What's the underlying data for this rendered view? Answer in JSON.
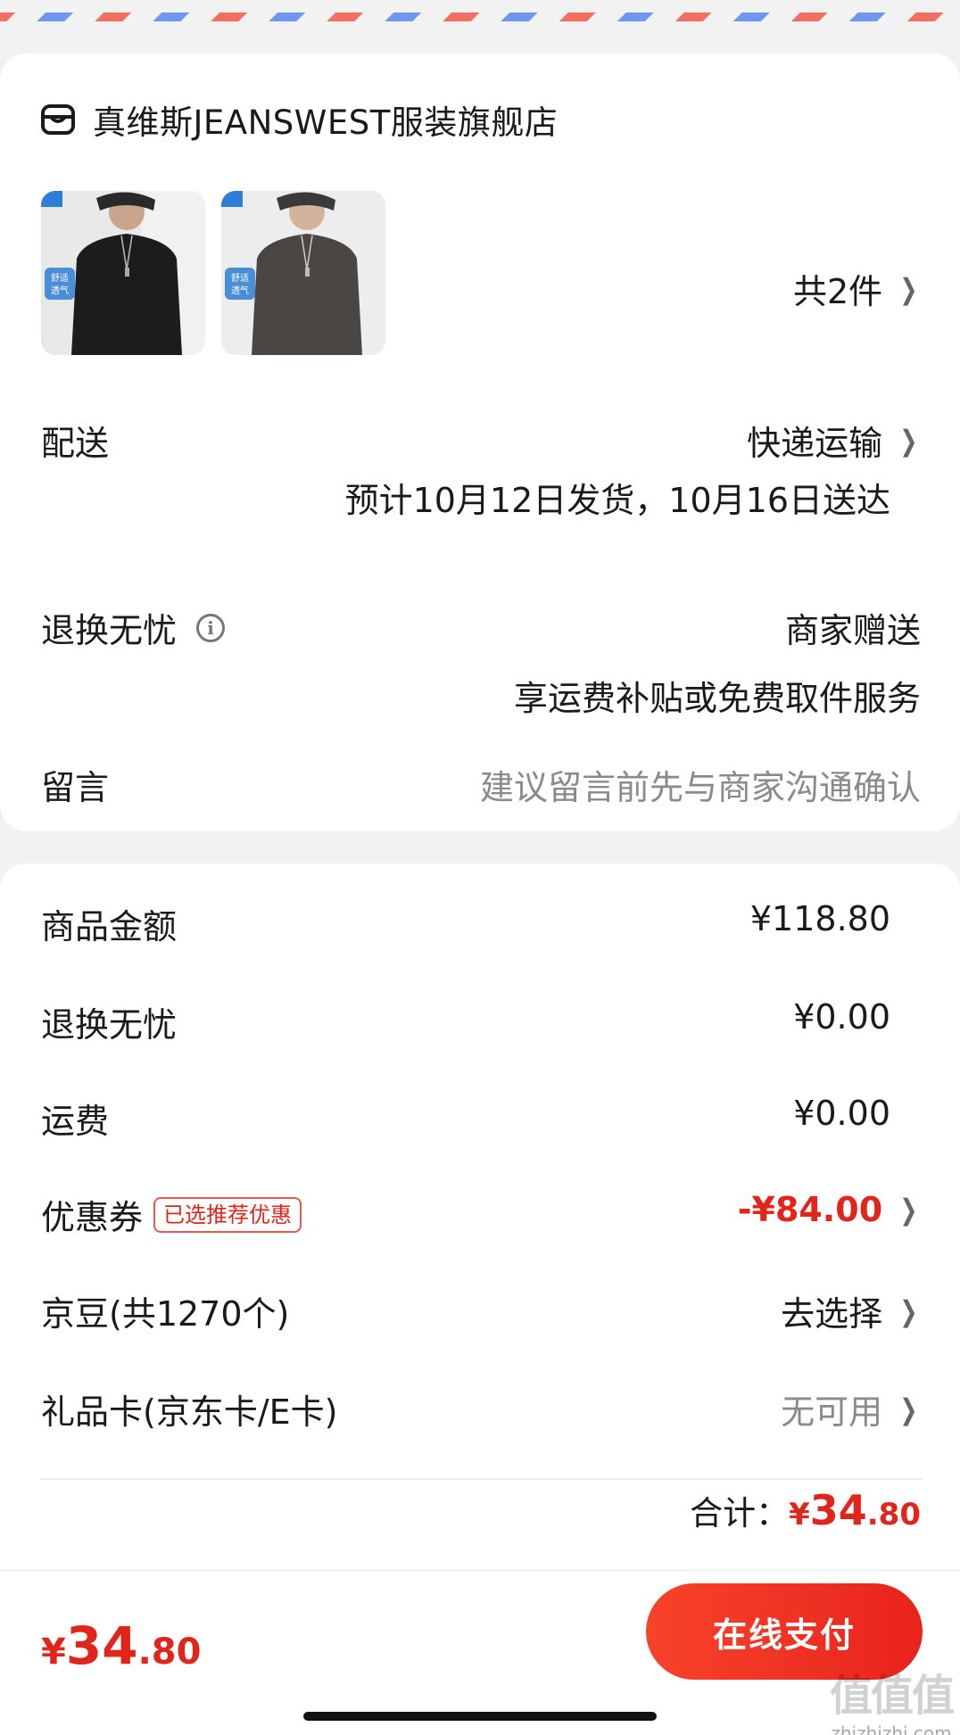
{
  "store": {
    "name": "真维斯JEANSWEST服装旗舰店",
    "icon": "store-icon"
  },
  "products": {
    "items": [
      {
        "tag": "舒适透气",
        "color": "#1a1a1a"
      },
      {
        "tag": "舒适透气",
        "color": "#4a4644"
      }
    ],
    "count_label": "共2件"
  },
  "delivery": {
    "label": "配送",
    "method": "快递运输",
    "estimate": "预计10月12日发货，10月16日送达"
  },
  "returns": {
    "label": "退换无忧",
    "value": "商家赠送",
    "desc": "享运费补贴或免费取件服务"
  },
  "message": {
    "label": "留言",
    "placeholder": "建议留言前先与商家沟通确认"
  },
  "price": {
    "goods_label": "商品金额",
    "goods_value": "¥118.80",
    "returns_label": "退换无忧",
    "returns_value": "¥0.00",
    "shipping_label": "运费",
    "shipping_value": "¥0.00",
    "coupon_label": "优惠券",
    "coupon_tag": "已选推荐优惠",
    "coupon_value": "-¥84.00",
    "jingdou_label": "京豆(共1270个)",
    "jingdou_value": "去选择",
    "giftcard_label": "礼品卡(京东卡/E卡)",
    "giftcard_value": "无可用",
    "total_label": "合计：",
    "total_yen": "¥",
    "total_int": "34",
    "total_dec": ".80"
  },
  "bottom": {
    "yen": "¥",
    "int": "34",
    "dec": ".80",
    "pay_label": "在线支付"
  },
  "watermark": {
    "text": "值值值",
    "url": "zhizhizhi.com"
  },
  "colors": {
    "accent": "#e1251b",
    "airmail_red": "#f36f5f",
    "airmail_blue": "#6e98ef"
  }
}
